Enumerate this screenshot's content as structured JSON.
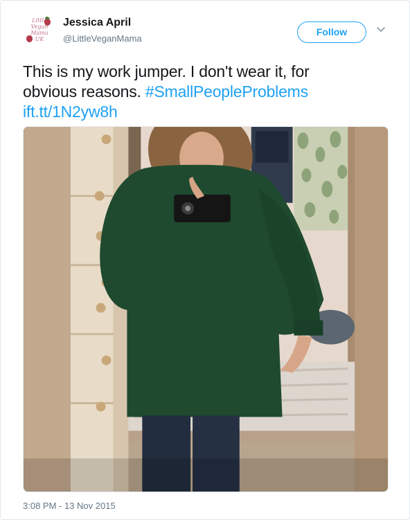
{
  "author": {
    "name": "Jessica April",
    "handle": "@LittleVeganMama",
    "avatar_text": "Little\nVegan\nMama\nUK"
  },
  "follow_label": "Follow",
  "tweet": {
    "text_plain_1": "This is my work jumper. I don't wear it, for",
    "text_plain_2": "obvious reasons. ",
    "hashtag": "#SmallPeopleProblems",
    "link": "ift.tt/1N2yw8h"
  },
  "timestamp": "3:08 PM - 13 Nov 2015",
  "icons": {
    "more": "chevron-down-icon"
  },
  "colors": {
    "accent": "#1da1f2",
    "secondary_text": "#657786",
    "jumper": "#1e4a2e"
  }
}
